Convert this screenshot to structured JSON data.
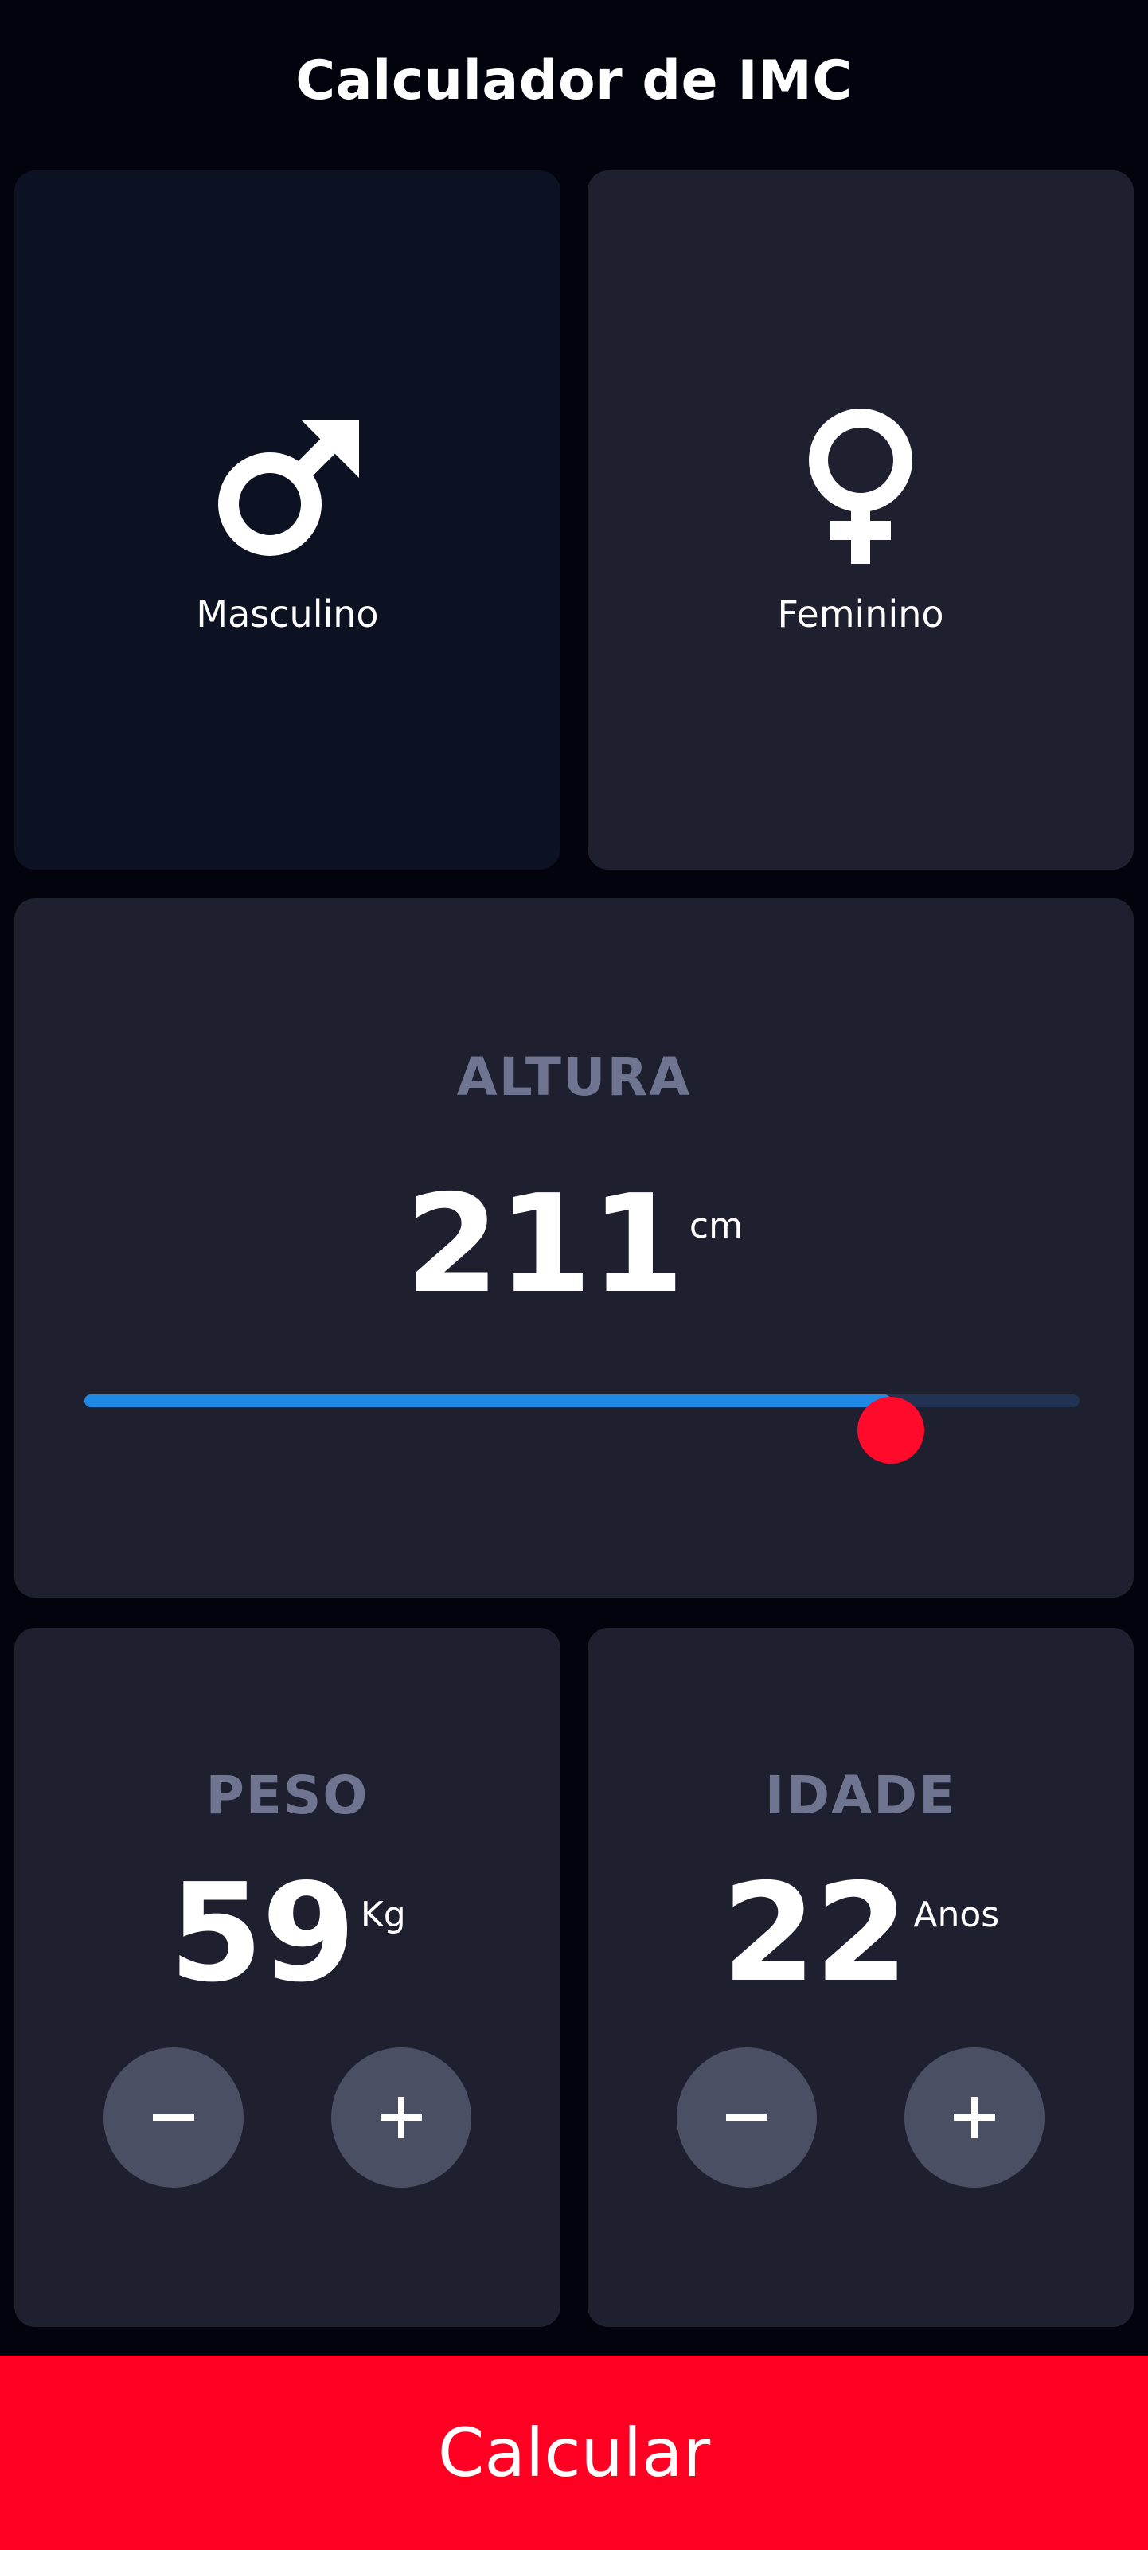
{
  "app": {
    "title": "Calculador de IMC"
  },
  "gender": {
    "selected": "Masculino",
    "options": [
      {
        "label": "Masculino",
        "icon": "male-symbol-icon"
      },
      {
        "label": "Feminino",
        "icon": "female-symbol-icon"
      }
    ]
  },
  "height": {
    "label": "ALTURA",
    "value": "211",
    "unit": "cm",
    "slider_fraction": 0.81
  },
  "weight": {
    "label": "PESO",
    "value": "59",
    "unit": "Kg",
    "decrement_icon": "minus-icon",
    "increment_icon": "plus-icon"
  },
  "age": {
    "label": "IDADE",
    "value": "22",
    "unit": "Anos",
    "decrement_icon": "minus-icon",
    "increment_icon": "plus-icon"
  },
  "action": {
    "label": "Calcular"
  },
  "colors": {
    "background": "#02030D",
    "card": "#1E1F2F",
    "card_selected": "#0D1222",
    "label_muted": "#6F7591",
    "slider_active": "#1E88E5",
    "slider_inactive": "#213252",
    "accent": "#FF0022",
    "round_button": "#4B4F63"
  }
}
